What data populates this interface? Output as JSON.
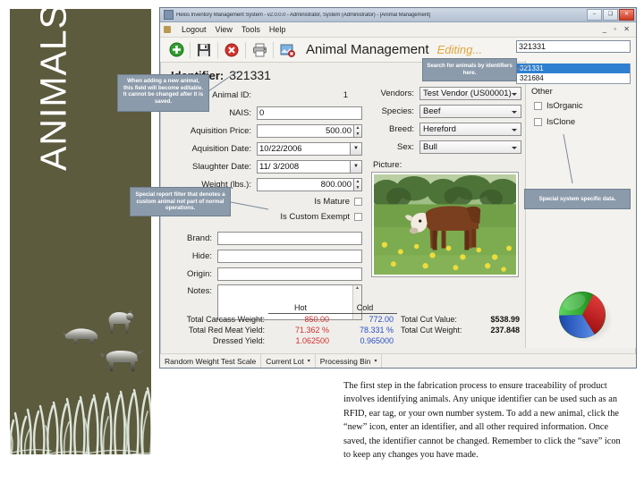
{
  "slide": {
    "sidebar_title": "ANIMALS",
    "body_paragraph": "The first step in the fabrication process to ensure traceability of product involves identifying animals. Any unique identifier can be used such as an RFID, ear tag, or your own number system. To add a new animal, click the “new” icon, enter an identifier, and all other required information. Once saved, the identifier cannot be changed. Remember to click the “save” icon to keep any changes you have made."
  },
  "callouts": {
    "identifier": "When adding a new animal, this field will become editable. It cannot be changed after it is saved.",
    "search": "Search for animals by identifiers here.",
    "custom_exempt": "Special report filter that denotes a custom animal not part of normal operations.",
    "other": "Special system specific data."
  },
  "window": {
    "title": "Helos Inventory Management System - v2.0.0.0 - Administrator, System (Administrator) - [Animal Management]",
    "minimize": "–",
    "maximize": "❑",
    "close": "✕",
    "mdi_buttons": "_ ▫ ✕"
  },
  "menu": {
    "items": [
      "Logout",
      "View",
      "Tools",
      "Help"
    ]
  },
  "toolbar": {
    "new_label": "new-record",
    "save_label": "save-record",
    "delete_label": "delete-record",
    "print_label": "print",
    "image_delete_label": "delete-image",
    "screen_title": "Animal Management",
    "status": "Editing..."
  },
  "search": {
    "value": "321331",
    "results": [
      "321331",
      "321684"
    ],
    "selected_index": 0
  },
  "form": {
    "identifier_label": "Identifier:",
    "identifier_value": "321331",
    "fields": [
      {
        "label": "Animal ID:",
        "value": "1",
        "type": "readonly"
      },
      {
        "label": "NAIS:",
        "value": "0",
        "type": "text"
      },
      {
        "label": "Aquisition Price:",
        "value": "500.00",
        "type": "spinner"
      },
      {
        "label": "Aquisition Date:",
        "value": "10/22/2006",
        "type": "date"
      },
      {
        "label": "Slaughter Date:",
        "value": "11/ 3/2008",
        "type": "date"
      },
      {
        "label": "Weight (lbs.):",
        "value": "800.000",
        "type": "spinner"
      }
    ],
    "checkboxes": [
      {
        "label": "Is Mature",
        "checked": false
      },
      {
        "label": "Is Custom Exempt",
        "checked": false
      }
    ],
    "text_fields": [
      {
        "label": "Brand:",
        "value": ""
      },
      {
        "label": "Hide:",
        "value": ""
      },
      {
        "label": "Origin:",
        "value": ""
      }
    ],
    "notes_label": "Notes:",
    "notes_value": "",
    "combos": [
      {
        "label": "Vendors:",
        "value": "Test Vendor (US00001)"
      },
      {
        "label": "Species:",
        "value": "Beef"
      },
      {
        "label": "Breed:",
        "value": "Hereford"
      },
      {
        "label": "Sex:",
        "value": "Bull"
      }
    ],
    "picture_label": "Picture:"
  },
  "other_panel": {
    "title": "Other",
    "options": [
      {
        "label": "IsOrganic",
        "checked": false
      },
      {
        "label": "IsClone",
        "checked": false
      }
    ]
  },
  "stats": {
    "head_hot": "Hot",
    "head_cold": "Cold",
    "rows": [
      {
        "label": "Total Carcass Weight:",
        "hot": "850.00",
        "cold": "772.00"
      },
      {
        "label": "Total Red Meat Yield:",
        "hot": "71.362 %",
        "cold": "78.331 %"
      },
      {
        "label": "Dressed Yield:",
        "hot": "1.062500",
        "cold": "0.965000"
      }
    ],
    "totals": [
      {
        "label": "Total Cut Value:",
        "value": "$538.99"
      },
      {
        "label": "Total Cut Weight:",
        "value": "237.848"
      }
    ]
  },
  "statusbar": {
    "scale": "Random Weight Test Scale",
    "lot": "Current Lot",
    "bin": "Processing Bin",
    "caret": "▾"
  },
  "colors": {
    "olive": "#5d5b3e",
    "callout_fill": "#8c9bab",
    "editing": "#e0a63c",
    "hot": "#d03030",
    "cold": "#2a4fc4",
    "select_blue": "#2f7fd0"
  }
}
